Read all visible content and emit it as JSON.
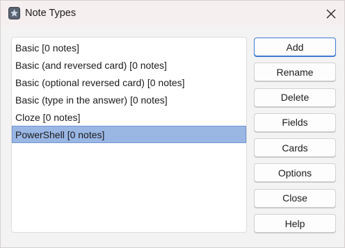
{
  "window": {
    "title": "Note Types",
    "app_icon": "anki-icon",
    "close_icon": "close-icon"
  },
  "note_types": [
    {
      "label": "Basic [0 notes]",
      "selected": false
    },
    {
      "label": "Basic (and reversed card) [0 notes]",
      "selected": false
    },
    {
      "label": "Basic (optional reversed card) [0 notes]",
      "selected": false
    },
    {
      "label": "Basic (type in the answer) [0 notes]",
      "selected": false
    },
    {
      "label": "Cloze [0 notes]",
      "selected": false
    },
    {
      "label": "PowerShell [0 notes]",
      "selected": true
    }
  ],
  "buttons": {
    "add": "Add",
    "rename": "Rename",
    "delete": "Delete",
    "fields": "Fields",
    "cards": "Cards",
    "options": "Options",
    "close": "Close",
    "help": "Help"
  },
  "colors": {
    "selection": "#9ab7e4",
    "default_button_border": "#3d7ad6"
  }
}
